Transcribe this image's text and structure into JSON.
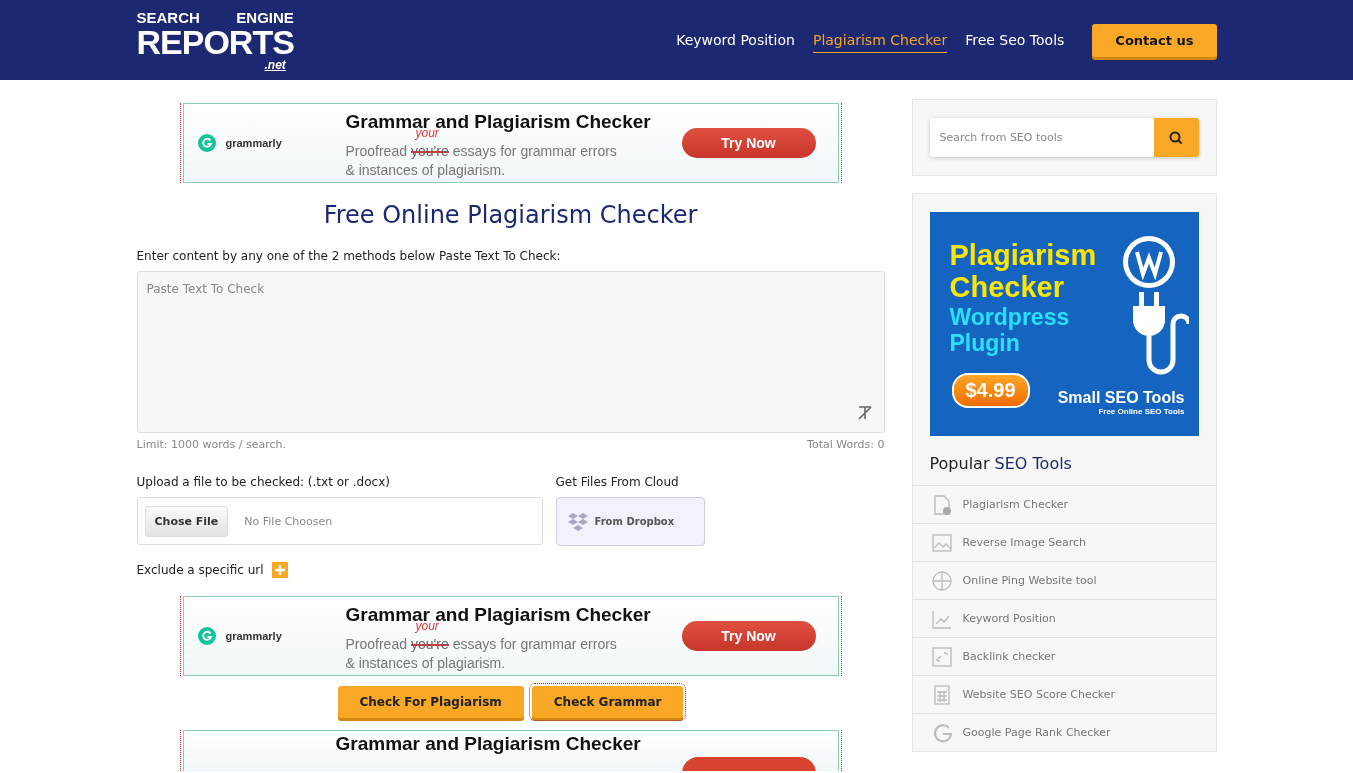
{
  "header": {
    "logo": {
      "top_left": "SEARCH",
      "top_right": "ENGINE",
      "main": "REPORTS",
      "sub": ".net"
    },
    "nav": [
      {
        "label": "Keyword Position",
        "selected": false
      },
      {
        "label": "Plagiarism Checker",
        "selected": true
      },
      {
        "label": "Free Seo Tools",
        "selected": false
      }
    ],
    "contact_button": "Contact us"
  },
  "ads": [
    {
      "brand": "grammarly",
      "title": "Grammar and Plagiarism Checker",
      "before": "Proofread",
      "struck": "you're",
      "correction": "your",
      "after": "essays for grammar errors",
      "line2": "& instances of plagiarism.",
      "button": "Try Now"
    },
    {
      "brand": "grammarly",
      "title": "Grammar and Plagiarism Checker",
      "before": "Proofread",
      "struck": "you're",
      "correction": "your",
      "after": "essays for grammar errors",
      "line2": "& instances of plagiarism.",
      "button": "Try Now"
    },
    {
      "title": "Grammar and Plagiarism Checker"
    }
  ],
  "main": {
    "title": "Free Online Plagiarism Checker",
    "instructions": "Enter content by any one of the 2 methods below Paste Text To Check:",
    "textarea": {
      "placeholder": "Paste Text To Check"
    },
    "limit": "Limit: 1000 words / search.",
    "total_words": "Total Words: 0",
    "upload_label": "Upload a file to be checked: (.txt or .docx)",
    "choose_button": "Chose File",
    "file_status": "No File Choosen",
    "cloud_label": "Get Files From Cloud",
    "dropbox_button": "From Dropbox",
    "exclude_label": "Exclude a specific url",
    "buttons": [
      "Check For Plagiarism",
      "Check Grammar"
    ]
  },
  "sidebar": {
    "search": {
      "placeholder": "Search from SEO tools"
    },
    "promo": {
      "line1": "Plagiarism",
      "line2": "Checker",
      "line3": "Wordpress",
      "line4": "Plugin",
      "price": "$4.99",
      "brand": "Small SEO Tools",
      "tagline": "Free Online SEO Tools"
    },
    "popular_title": {
      "plain": "Popular",
      "accent": "SEO Tools"
    },
    "items": [
      {
        "label": "Plagiarism Checker",
        "kind": "document"
      },
      {
        "label": "Reverse Image Search",
        "kind": "image"
      },
      {
        "label": "Online Ping Website tool",
        "kind": "globe"
      },
      {
        "label": "Keyword Position",
        "kind": "chart"
      },
      {
        "label": "Backlink checker",
        "kind": "link"
      },
      {
        "label": "Website SEO Score Checker",
        "kind": "calculator"
      },
      {
        "label": "Google Page Rank Checker",
        "kind": "google"
      }
    ]
  }
}
